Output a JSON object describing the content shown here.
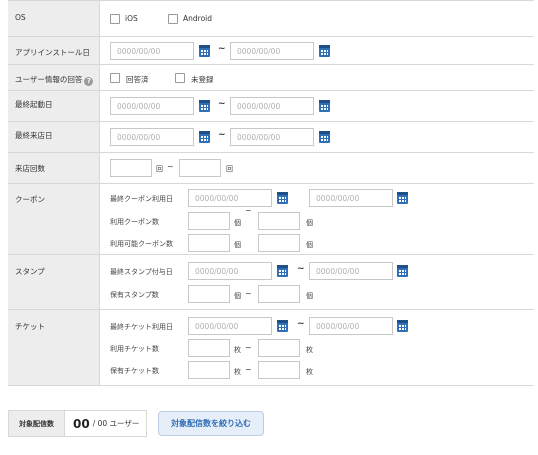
{
  "os": {
    "label": "OS",
    "options": [
      "iOS",
      "Android"
    ]
  },
  "install_date": {
    "label": "アプリインストール日",
    "from_placeholder": "0000/00/00",
    "to_placeholder": "0000/00/00"
  },
  "user_info": {
    "label": "ユーザー情報の回答",
    "help": "?",
    "options": [
      "回答済",
      "未登録"
    ]
  },
  "last_launch": {
    "label": "最終起動日",
    "from_placeholder": "0000/00/00",
    "to_placeholder": "0000/00/00"
  },
  "last_visit": {
    "label": "最終来店日",
    "from_placeholder": "0000/00/00",
    "to_placeholder": "0000/00/00"
  },
  "visit_count": {
    "label": "来店回数",
    "unit1": "回",
    "unit2": "回"
  },
  "coupon": {
    "label": "クーポン",
    "last_use_label": "最終クーポン利用日",
    "from_placeholder": "0000/00/00",
    "to_placeholder": "0000/00/00",
    "used_label": "利用クーポン数",
    "available_label": "利用可能クーポン数",
    "unit": "個"
  },
  "stamp": {
    "label": "スタンプ",
    "last_grant_label": "最終スタンプ付与日",
    "from_placeholder": "0000/00/00",
    "to_placeholder": "0000/00/00",
    "owned_label": "保有スタンプ数",
    "unit": "個"
  },
  "ticket": {
    "label": "チケット",
    "last_use_label": "最終チケット利用日",
    "from_placeholder": "0000/00/00",
    "to_placeholder": "0000/00/00",
    "used_label": "利用チケット数",
    "owned_label": "保有チケット数",
    "unit": "枚"
  },
  "tilde": "~",
  "summary": {
    "label": "対象配信数",
    "count": "00",
    "rest": "/ 00 ユーザー",
    "button": "対象配信数を絞り込む"
  },
  "colors": {
    "calendar": "#2e6fb7",
    "button_text": "#2f6db5",
    "label_bg": "#ededed"
  }
}
